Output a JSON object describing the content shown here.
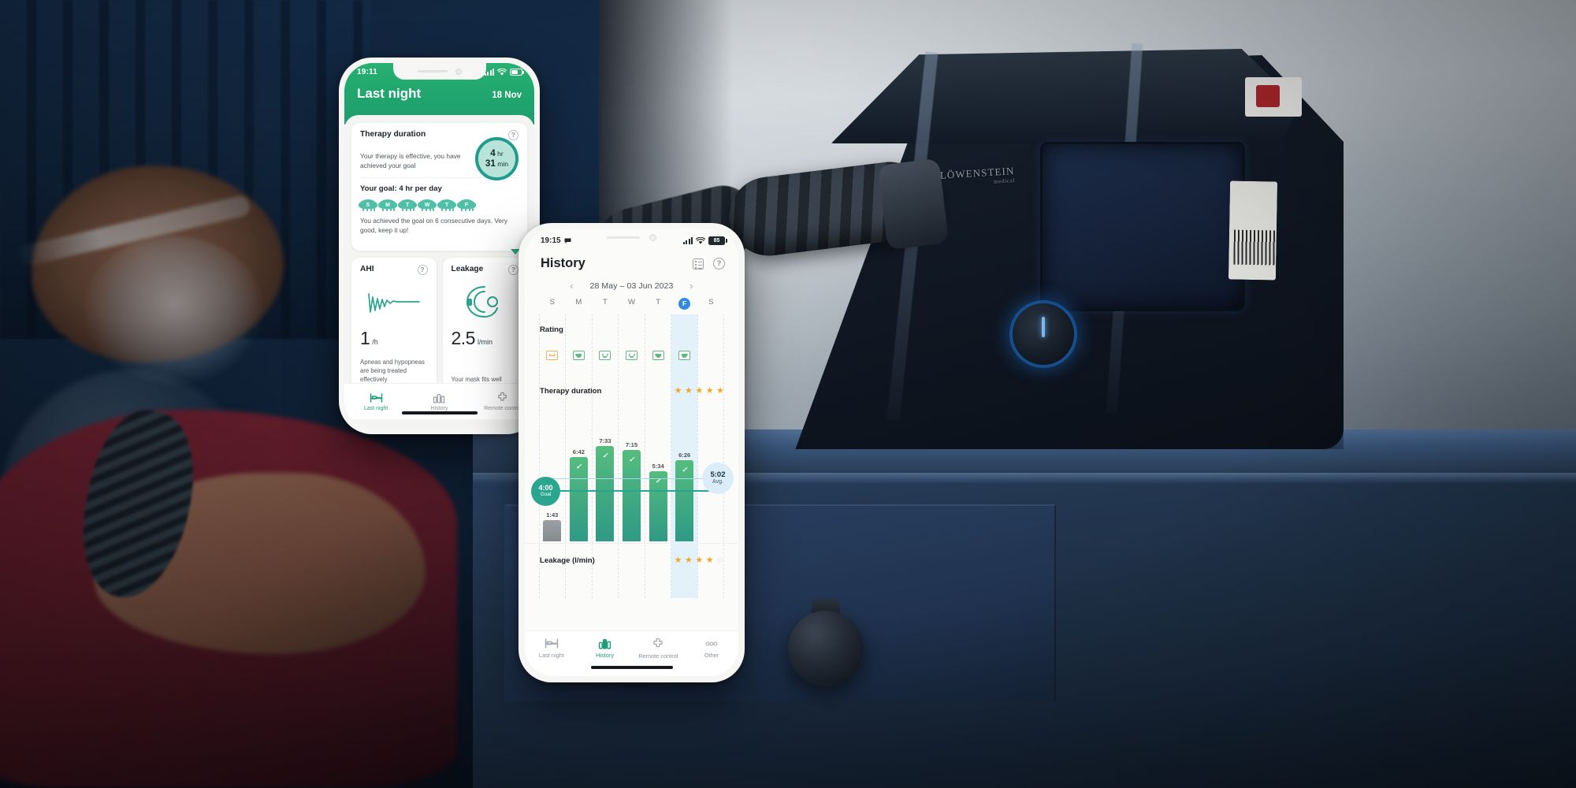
{
  "background": {
    "device_brand": "LÖWENSTEIN",
    "device_brand_sub": "medical"
  },
  "phone1": {
    "status": {
      "time": "19:11"
    },
    "header": {
      "title": "Last night",
      "date": "18 Nov"
    },
    "therapy_card": {
      "title": "Therapy duration",
      "help_icon": "?",
      "duration_hours": "4",
      "hours_unit": "hr",
      "duration_minutes": "31",
      "minutes_unit": "min",
      "effective_text": "Your therapy is effective, you have achieved your goal",
      "goal_text": "Your goal: 4 hr per day",
      "days": [
        {
          "letter": "S"
        },
        {
          "letter": "M"
        },
        {
          "letter": "T"
        },
        {
          "letter": "W"
        },
        {
          "letter": "T"
        },
        {
          "letter": "F"
        }
      ],
      "consecutive_text": "You achieved the goal on 6 consecutive days. Very good, keep it up!"
    },
    "ahi_card": {
      "title": "AHI",
      "help_icon": "?",
      "value": "1",
      "unit": "/h",
      "description": "Apneas and hypopneas are being treated effectively"
    },
    "leakage_card": {
      "title": "Leakage",
      "help_icon": "?",
      "value": "2.5",
      "unit": "l/min",
      "description": "Your mask fits well"
    },
    "tabs": [
      {
        "label": "Last night",
        "icon": "bed-icon",
        "active": true
      },
      {
        "label": "History",
        "icon": "bar-chart-icon",
        "active": false
      },
      {
        "label": "Remote control",
        "icon": "remote-control-icon",
        "active": false
      }
    ]
  },
  "phone2": {
    "status": {
      "time": "19:15",
      "battery": "85"
    },
    "header": {
      "title": "History",
      "list_icon": "list-icon",
      "help_icon": "?"
    },
    "date_nav": {
      "prev": "‹",
      "range": "28 May – 03 Jun 2023",
      "next": "›"
    },
    "weekdays": [
      {
        "letter": "S",
        "selected": false
      },
      {
        "letter": "M",
        "selected": false
      },
      {
        "letter": "T",
        "selected": false
      },
      {
        "letter": "W",
        "selected": false
      },
      {
        "letter": "T",
        "selected": false
      },
      {
        "letter": "F",
        "selected": true
      },
      {
        "letter": "S",
        "selected": false
      }
    ],
    "rating_section": {
      "label": "Rating"
    },
    "therapy_section": {
      "label": "Therapy duration",
      "stars_filled": 5,
      "stars_total": 5
    },
    "leakage_section": {
      "label": "Leakage (l/min)",
      "stars_filled": 4,
      "stars_total": 5
    },
    "goal": {
      "value": "4:00",
      "label": "Goal"
    },
    "average": {
      "value": "5:02",
      "label": "Avg."
    },
    "tabs": [
      {
        "label": "Last night",
        "icon": "bed-icon",
        "active": false
      },
      {
        "label": "History",
        "icon": "bar-chart-icon",
        "active": true
      },
      {
        "label": "Remote control",
        "icon": "remote-control-icon",
        "active": false
      },
      {
        "label": "Other",
        "icon": "more-dots-icon",
        "active": false
      }
    ]
  },
  "chart_data": {
    "type": "bar",
    "title": "Therapy duration",
    "xlabel": "",
    "ylabel": "Therapy duration (h:mm)",
    "categories": [
      "S",
      "M",
      "T",
      "W",
      "T",
      "F",
      "S"
    ],
    "labels": [
      "1:43",
      "6:42",
      "7:33",
      "7:15",
      "5:34",
      "6:26",
      ""
    ],
    "values": [
      1.717,
      6.7,
      7.55,
      7.25,
      5.567,
      6.433,
      null
    ],
    "bar_colors": [
      "#8f9599",
      "#3fa882",
      "#3fa882",
      "#3fa882",
      "#3fa882",
      "#3fa882",
      null
    ],
    "goal_line": 4.0,
    "goal_label": "4:00",
    "avg_line": 5.033,
    "avg_label": "5:02",
    "goal_met": [
      false,
      true,
      true,
      true,
      true,
      true,
      null
    ],
    "ylim": [
      0,
      8
    ],
    "grid": true,
    "legend": "none",
    "ratings": [
      "neutral",
      "happy",
      "slight-smile",
      "slight-smile",
      "happy",
      "happy",
      null
    ],
    "rating_colors": [
      "#e9b14c",
      "#5fb87f",
      "#5fb87f",
      "#5fb87f",
      "#5fb87f",
      "#5fb87f",
      null
    ],
    "selected_category_index": 5
  }
}
